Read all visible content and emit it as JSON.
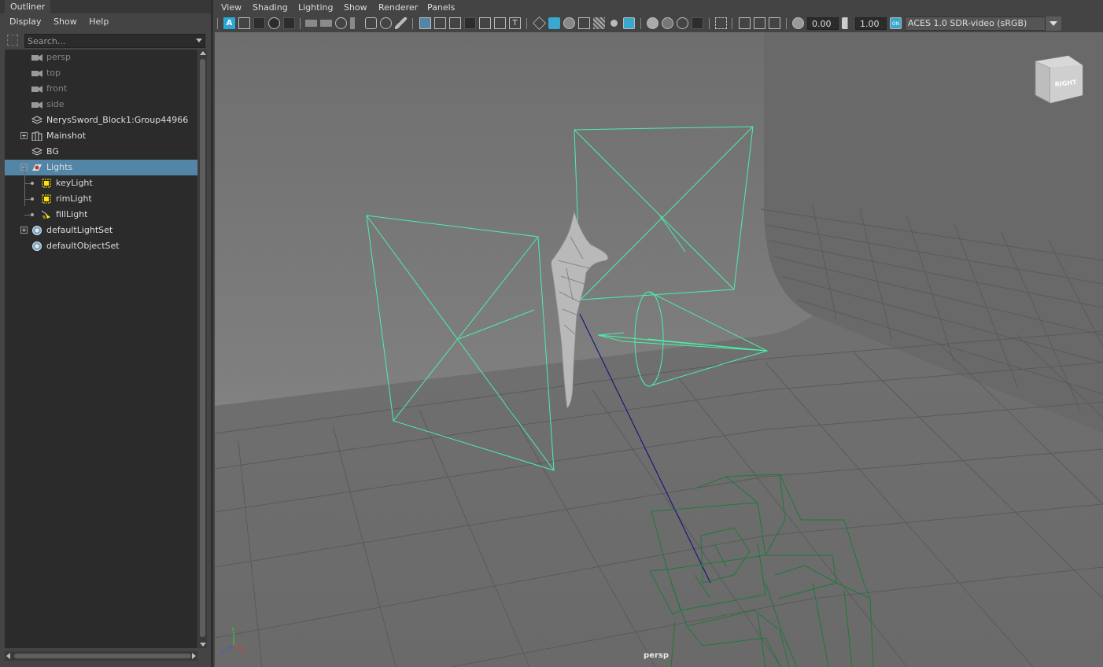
{
  "outliner": {
    "tab_title": "Outliner",
    "menu": [
      "Display",
      "Show",
      "Help"
    ],
    "search": {
      "placeholder": "Search...",
      "value": ""
    },
    "items": [
      {
        "label": "persp",
        "icon": "camera-icon"
      },
      {
        "label": "top",
        "icon": "camera-icon"
      },
      {
        "label": "front",
        "icon": "camera-icon"
      },
      {
        "label": "side",
        "icon": "camera-icon"
      },
      {
        "label": "NerysSword_Block1:Group44966",
        "icon": "mesh-transform-icon"
      },
      {
        "label": "Mainshot",
        "icon": "group-icon"
      },
      {
        "label": "BG",
        "icon": "mesh-transform-icon"
      },
      {
        "label": "Lights",
        "icon": "light-group-icon"
      },
      {
        "label": "keyLight",
        "icon": "area-light-icon"
      },
      {
        "label": "rimLight",
        "icon": "area-light-icon"
      },
      {
        "label": "fillLight",
        "icon": "spot-light-icon"
      },
      {
        "label": "defaultLightSet",
        "icon": "set-icon"
      },
      {
        "label": "defaultObjectSet",
        "icon": "set-icon"
      }
    ]
  },
  "viewport": {
    "menu": [
      "View",
      "Shading",
      "Lighting",
      "Show",
      "Renderer",
      "Panels"
    ],
    "exposure": "0.00",
    "gamma": "1.00",
    "color_management": "ACES 1.0 SDR-video (sRGB)",
    "camera_label": "persp",
    "view_cube_label": "RIGHT",
    "colors": {
      "light_wire": "#49f0aa",
      "camera_wire": "#1d7a3a",
      "selection": "#5285a6",
      "accent": "#2aa7d8"
    }
  }
}
